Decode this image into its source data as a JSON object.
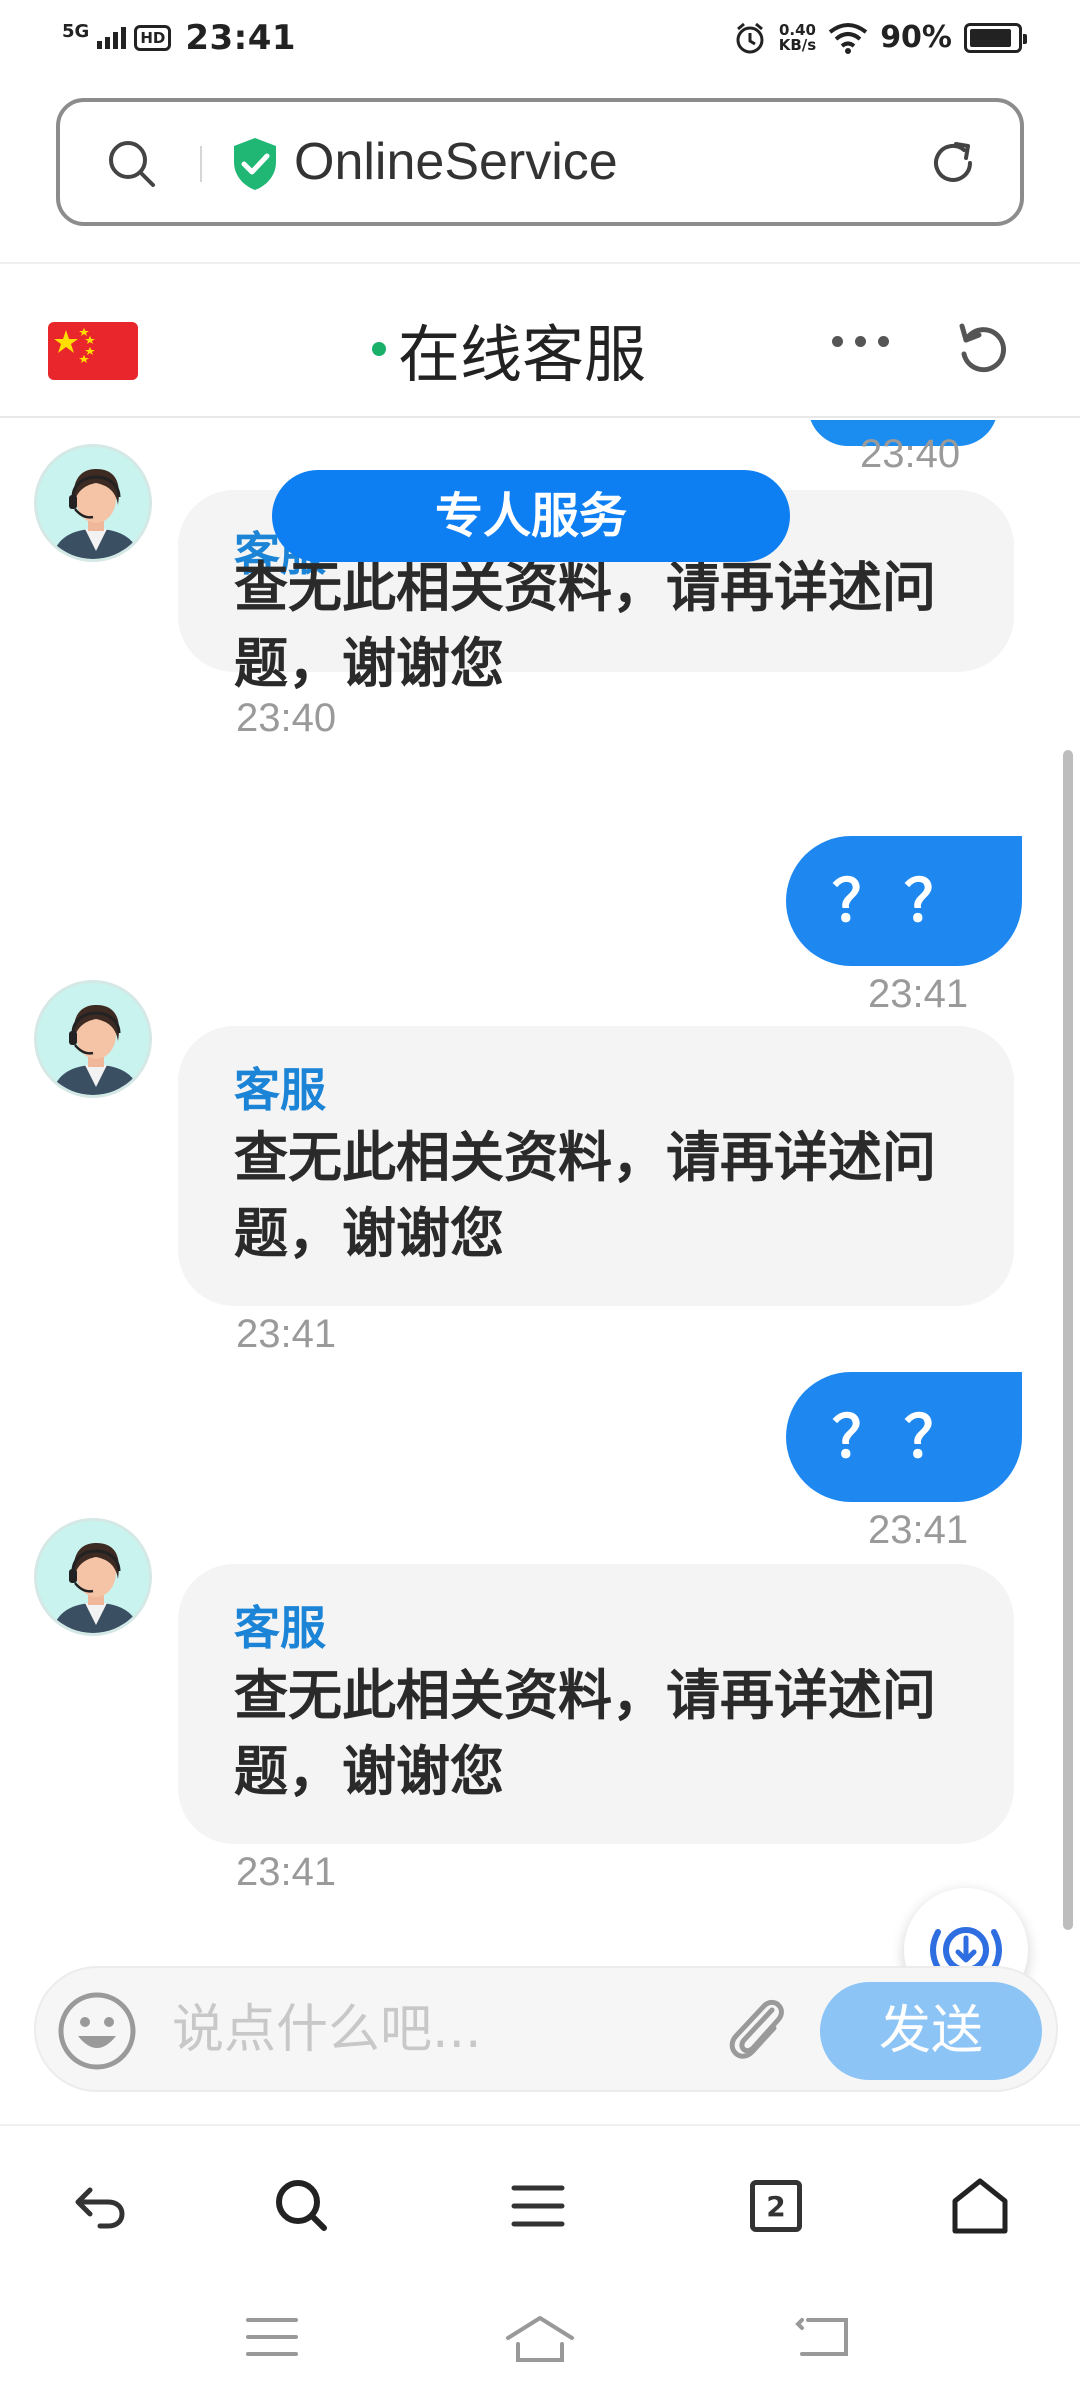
{
  "status_bar": {
    "network": "5G",
    "hd": "HD",
    "time": "23:41",
    "speed_top": "0.40",
    "speed_bottom": "KB/s",
    "battery": "90%",
    "battery_level": 0.9
  },
  "url_bar": {
    "site_name": "OnlineService",
    "icons": [
      "search-icon",
      "shield-check-icon",
      "reload-icon"
    ],
    "shield_color": "#20b774"
  },
  "chat_header": {
    "title": "在线客服",
    "flag": "china-flag-icon",
    "online_color": "#1ab06a",
    "icons": [
      "more-icon",
      "refresh-icon"
    ]
  },
  "banner": {
    "label": "专人服务"
  },
  "messages": [
    {
      "from": "agent",
      "sender": "客服",
      "text": "查无此相关资料，请再详述问题，谢谢您",
      "time": "23:40"
    },
    {
      "from": "user",
      "text": "？？",
      "time": "23:41"
    },
    {
      "from": "agent",
      "sender": "客服",
      "text": "查无此相关资料，请再详述问题，谢谢您",
      "time": "23:41"
    },
    {
      "from": "user",
      "text": "？？",
      "time": "23:41"
    },
    {
      "from": "agent",
      "sender": "客服",
      "text": "查无此相关资料，请再详述问题，谢谢您",
      "time": "23:41"
    }
  ],
  "prev_time": "23:40",
  "input": {
    "placeholder": "说点什么吧...",
    "value": "",
    "send_label": "发送"
  },
  "browser_nav": {
    "tab_count": "2",
    "items": [
      "back-icon",
      "search-icon",
      "menu-icon",
      "tabs-icon",
      "home-icon"
    ]
  },
  "system_nav": [
    "recents-icon",
    "home-icon",
    "back-icon"
  ],
  "colors": {
    "accent": "#1e88f0",
    "agent_bubble": "#f4f4f4",
    "sender_name": "#1b84d6",
    "send_disabled": "#8cc4f6"
  }
}
